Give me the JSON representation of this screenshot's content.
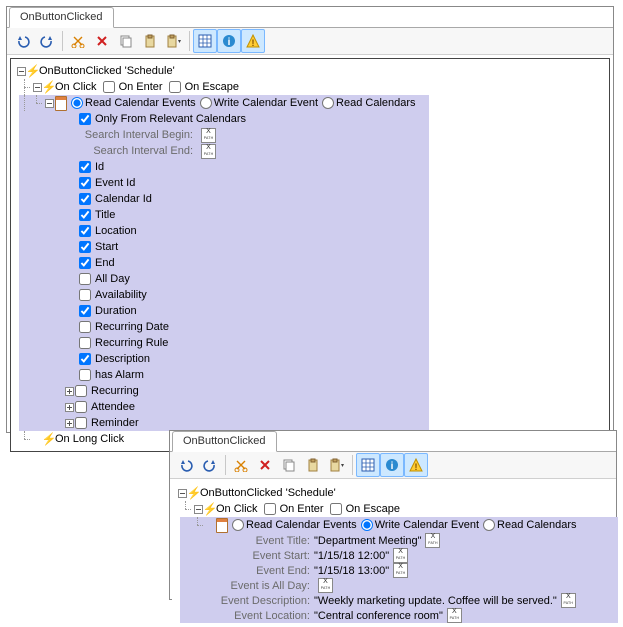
{
  "tab": "OnButtonClicked",
  "root": "OnButtonClicked  'Schedule'",
  "events": {
    "onClick": "On Click",
    "onEnter": "On Enter",
    "onEscape": "On Escape",
    "onLongClick": "On Long Click"
  },
  "calAction": {
    "read": "Read Calendar Events",
    "write": "Write Calendar Event",
    "readCals": "Read Calendars",
    "onlyRelevant": "Only From Relevant Calendars",
    "searchBegin": "Search Interval Begin:",
    "searchEnd": "Search Interval End:"
  },
  "fields": [
    {
      "label": "Id",
      "checked": true
    },
    {
      "label": "Event Id",
      "checked": true
    },
    {
      "label": "Calendar Id",
      "checked": true
    },
    {
      "label": "Title",
      "checked": true
    },
    {
      "label": "Location",
      "checked": true
    },
    {
      "label": "Start",
      "checked": true
    },
    {
      "label": "End",
      "checked": true
    },
    {
      "label": "All Day",
      "checked": false
    },
    {
      "label": "Availability",
      "checked": false
    },
    {
      "label": "Duration",
      "checked": true
    },
    {
      "label": "Recurring Date",
      "checked": false
    },
    {
      "label": "Recurring Rule",
      "checked": false
    },
    {
      "label": "Description",
      "checked": true
    },
    {
      "label": "has Alarm",
      "checked": false
    }
  ],
  "subgroups": [
    {
      "label": "Recurring"
    },
    {
      "label": "Attendee"
    },
    {
      "label": "Reminder"
    }
  ],
  "write": {
    "rows": [
      {
        "label": "Event Title:",
        "value": "Department Meeting",
        "xpath": true
      },
      {
        "label": "Event Start:",
        "value": "1/15/18 12:00",
        "xpath": true
      },
      {
        "label": "Event End:",
        "value": "1/15/18 13:00",
        "xpath": true
      },
      {
        "label": "Event is All Day:",
        "value": "",
        "xpath": true
      },
      {
        "label": "Event Description:",
        "value": "Weekly marketing update. Coffee will be served.",
        "xpath": true
      },
      {
        "label": "Event Location:",
        "value": "Central conference room",
        "xpath": true
      }
    ]
  }
}
